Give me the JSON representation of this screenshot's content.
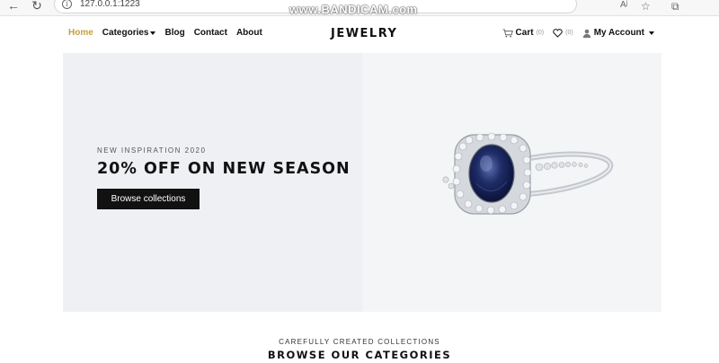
{
  "browser": {
    "url": "127.0.0.1:1223",
    "watermark": "www.BANDICAM.com",
    "read_aloud_label": "Aʲ"
  },
  "header": {
    "nav": [
      {
        "label": "Home",
        "active": true
      },
      {
        "label": "Categories",
        "has_dropdown": true
      },
      {
        "label": "Blog"
      },
      {
        "label": "Contact"
      },
      {
        "label": "About"
      }
    ],
    "brand": "JEWELRY",
    "cart_label": "Cart",
    "cart_count": "(0)",
    "wishlist_count": "(0)",
    "account_label": "My Account"
  },
  "hero": {
    "eyebrow": "NEW INSPIRATION 2020",
    "headline": "20% OFF ON NEW SEASON",
    "cta_label": "Browse collections"
  },
  "categories": {
    "subtitle": "CAREFULLY CREATED COLLECTIONS",
    "title": "BROWSE OUR CATEGORIES"
  },
  "icons": {
    "back": "arrow-left-icon",
    "reload": "reload-icon",
    "info": "info-icon",
    "read_aloud": "read-aloud-icon",
    "favorite": "star-icon",
    "collections": "collections-icon",
    "cart": "cart-icon",
    "wishlist": "heart-icon",
    "account": "user-icon"
  },
  "colors": {
    "accent": "#c8a13c",
    "hero_bg": "#eef0f3",
    "button_bg": "#111111"
  }
}
